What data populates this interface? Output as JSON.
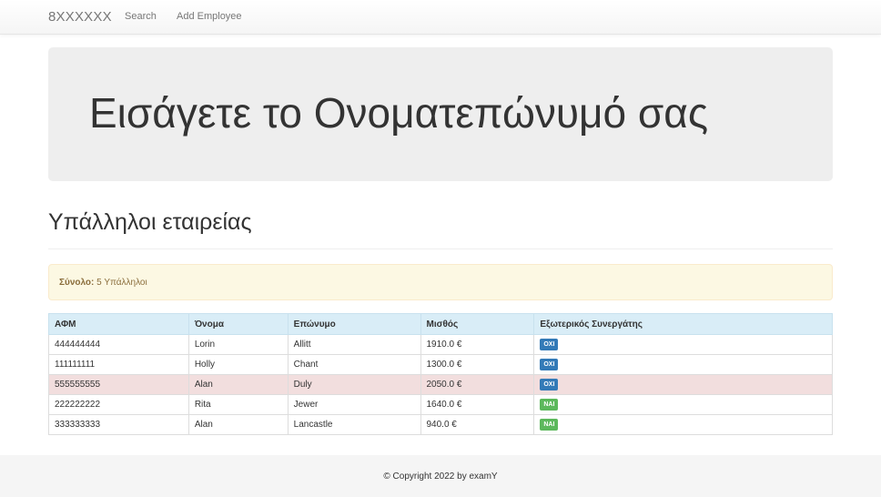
{
  "navbar": {
    "brand": "8XXXXXX",
    "links": [
      "Search",
      "Add Employee"
    ]
  },
  "jumbotron": {
    "heading": "Εισάγετε το Ονοματεπώνυμό σας"
  },
  "page_header": {
    "title": "Υπάλληλοι εταιρείας"
  },
  "alert": {
    "label": "Σύνολο:",
    "text": "5 Υπάλληλοι"
  },
  "table": {
    "headers": [
      "ΑΦΜ",
      "Όνομα",
      "Επώνυμο",
      "Μισθός",
      "Εξωτερικός Συνεργάτης"
    ],
    "rows": [
      {
        "afm": "444444444",
        "name": "Lorin",
        "surname": "Allitt",
        "salary": "1910.0 €",
        "external": "ΟΧΙ",
        "highlight": false
      },
      {
        "afm": "111111111",
        "name": "Holly",
        "surname": "Chant",
        "salary": "1300.0 €",
        "external": "ΟΧΙ",
        "highlight": false
      },
      {
        "afm": "555555555",
        "name": "Alan",
        "surname": "Duly",
        "salary": "2050.0 €",
        "external": "ΟΧΙ",
        "highlight": true
      },
      {
        "afm": "222222222",
        "name": "Rita",
        "surname": "Jewer",
        "salary": "1640.0 €",
        "external": "ΝΑΙ",
        "highlight": false
      },
      {
        "afm": "333333333",
        "name": "Alan",
        "surname": "Lancastle",
        "salary": "940.0 €",
        "external": "ΝΑΙ",
        "highlight": false
      }
    ]
  },
  "footer": {
    "copyright": "© Copyright 2022 by examY"
  },
  "colors": {
    "header_bg": "#d9edf7",
    "highlight_row": "#f2dede",
    "badge_no": "#337ab7",
    "badge_yes": "#5cb85c",
    "alert_bg": "#fcf8e3"
  }
}
